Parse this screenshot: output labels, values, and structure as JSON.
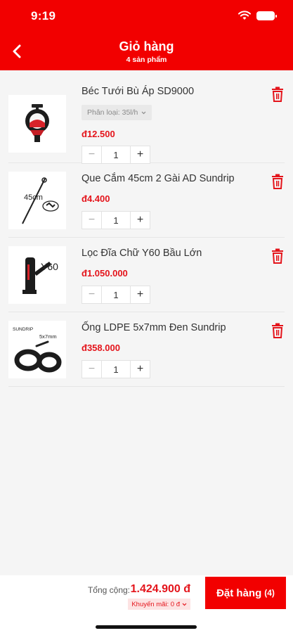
{
  "status_bar": {
    "time": "9:19"
  },
  "header": {
    "title": "Giỏ hàng",
    "subtitle": "4 sản phẩm"
  },
  "items": [
    {
      "name": "Béc Tưới Bù Áp SD9000",
      "variant": "Phân loại: 35l/h",
      "price": "đ12.500",
      "quantity": "1"
    },
    {
      "name": "Que Cắm 45cm 2 Gài AD Sundrip",
      "price": "đ4.400",
      "quantity": "1",
      "image_label": "45cm"
    },
    {
      "name": "Lọc Đĩa Chữ Y60 Bầu Lớn",
      "price": "đ1.050.000",
      "quantity": "1",
      "image_label": "Y60"
    },
    {
      "name": "Ống LDPE 5x7mm Đen Sundrip",
      "price": "đ358.000",
      "quantity": "1",
      "image_label_brand": "SUNDRIP",
      "image_label_size": "5x7mm"
    }
  ],
  "footer": {
    "total_label": "Tổng cộng:",
    "total_value": "1.424.900 đ",
    "promo_label": "Khuyến mãi: 0 đ",
    "order_label": "Đặt hàng",
    "order_count": "(4)"
  },
  "colors": {
    "brand": "#f20000",
    "price": "#e4141b",
    "background": "#f5f5f5"
  }
}
